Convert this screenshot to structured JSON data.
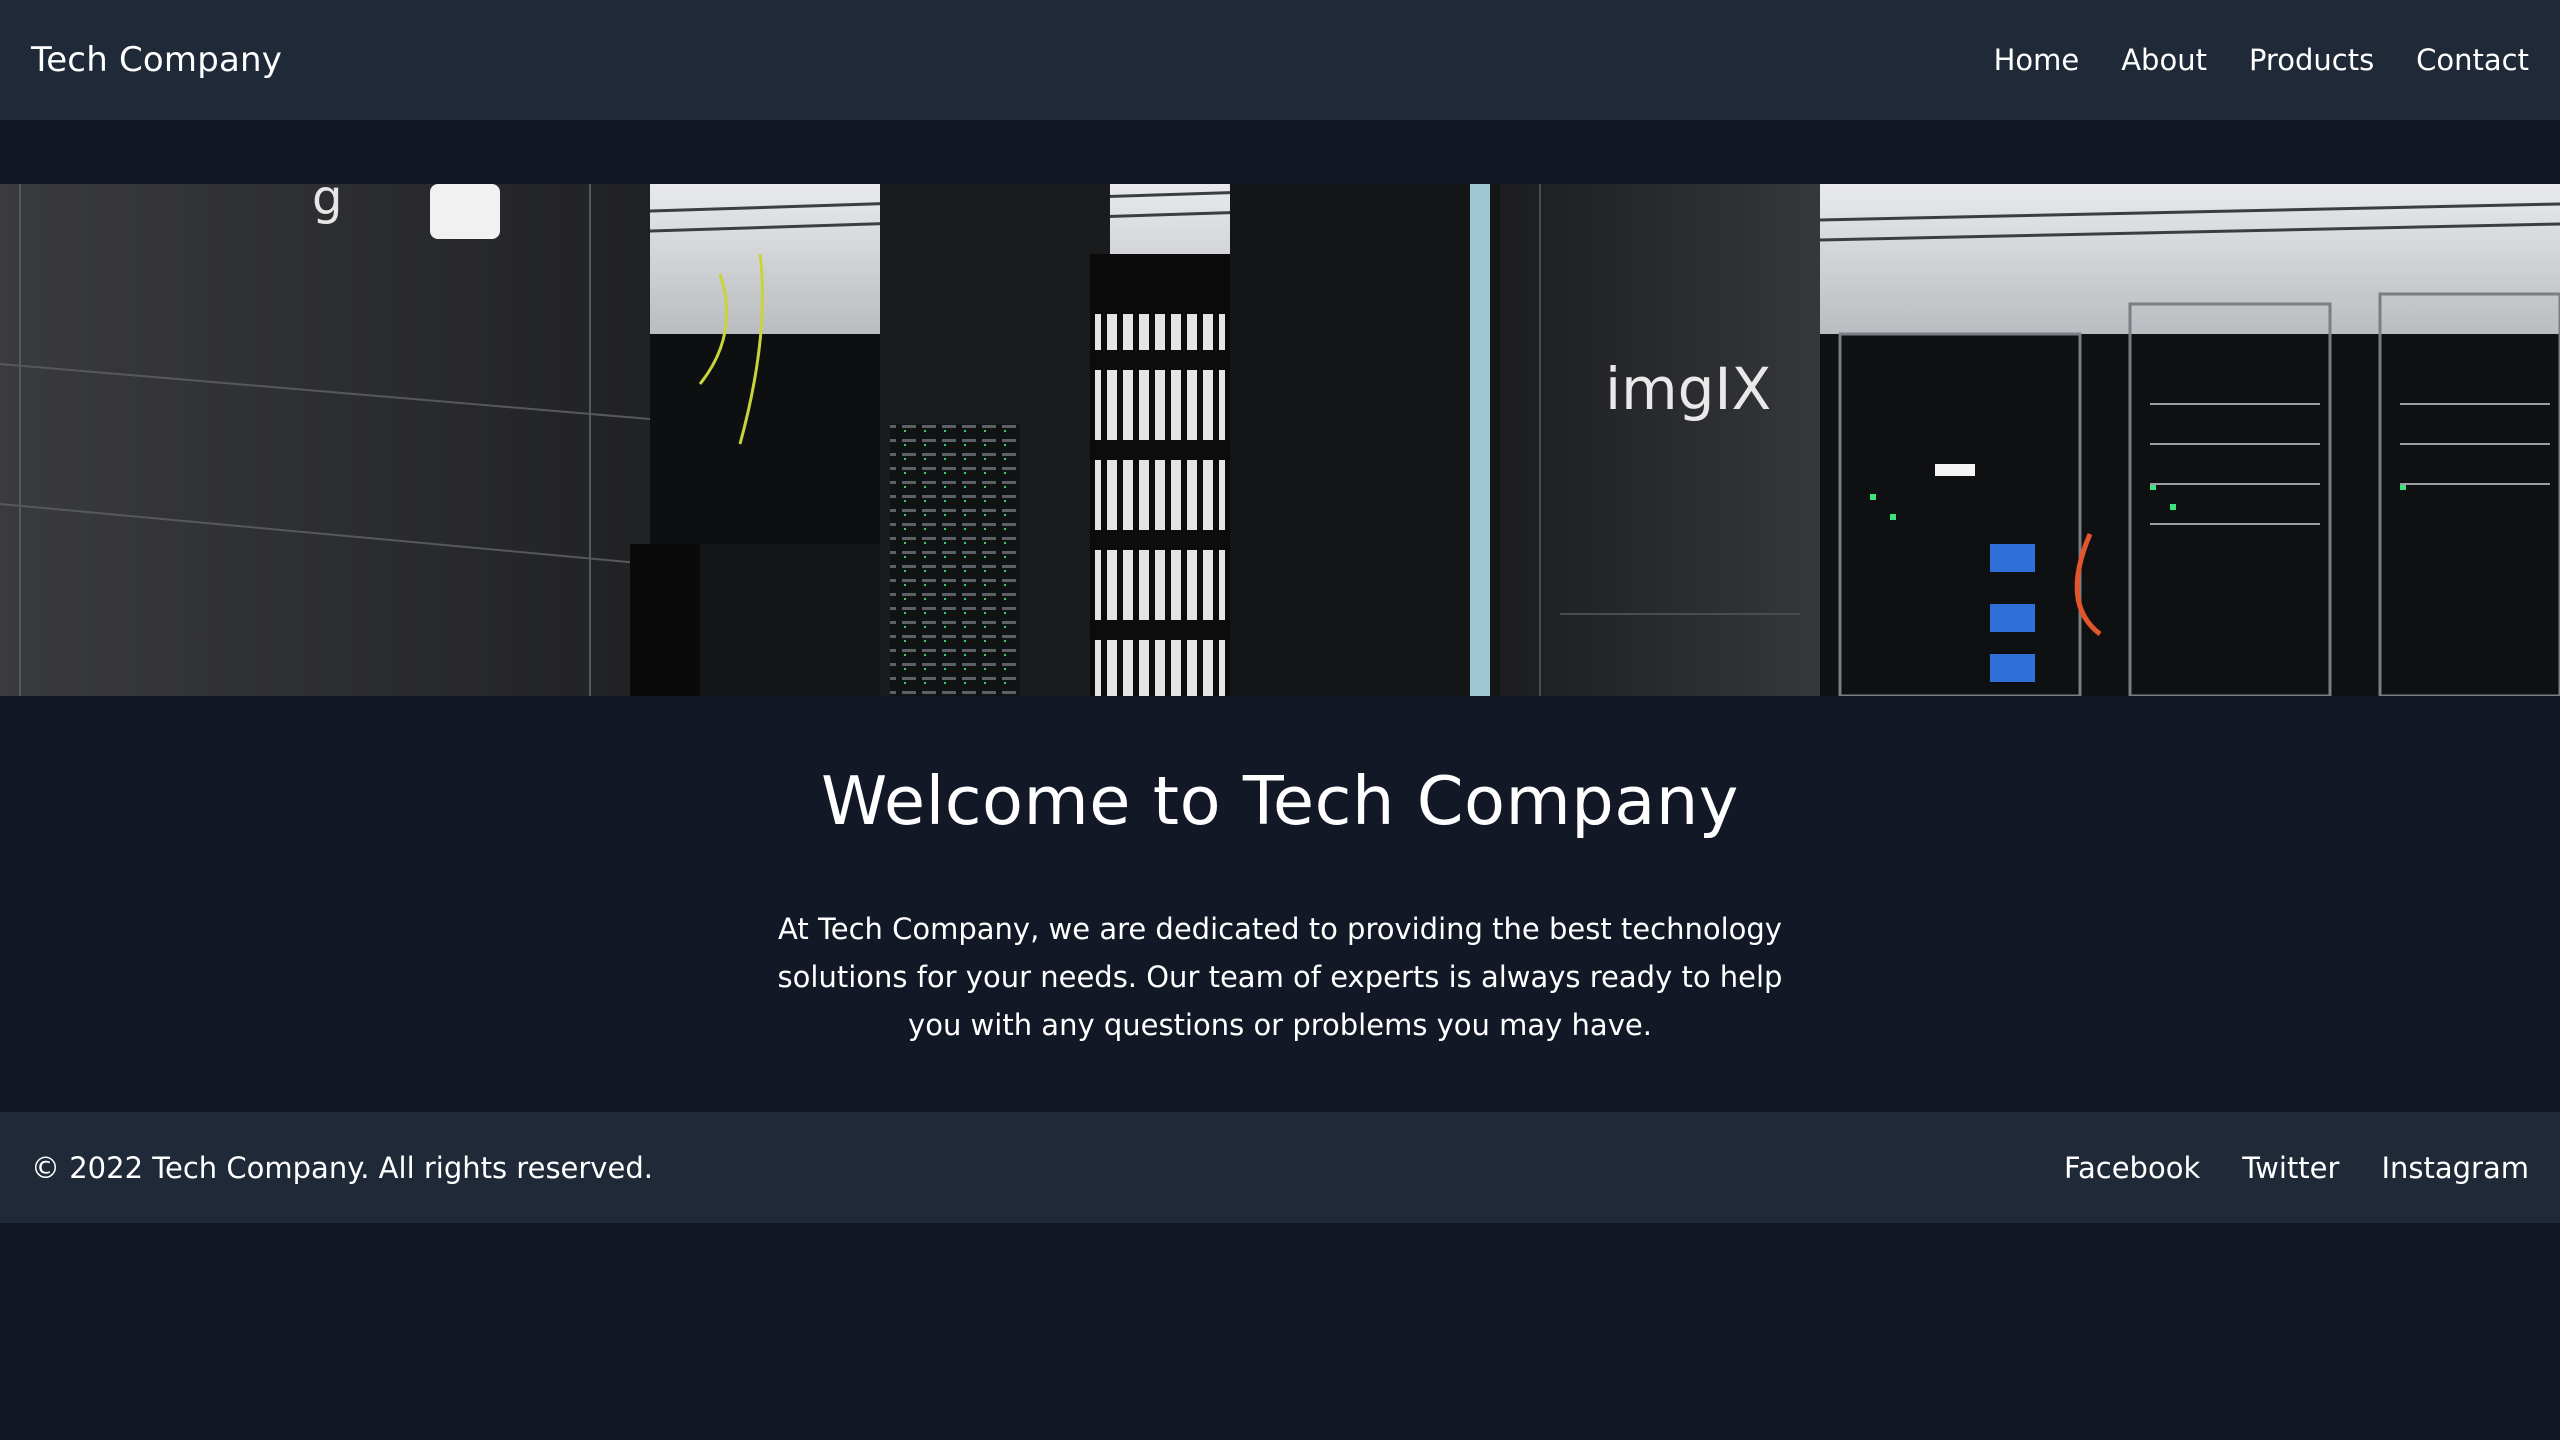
{
  "header": {
    "brand": "Tech Company",
    "nav": [
      {
        "label": "Home"
      },
      {
        "label": "About"
      },
      {
        "label": "Products"
      },
      {
        "label": "Contact"
      }
    ]
  },
  "hero": {
    "image_label": "imgIX"
  },
  "main": {
    "title": "Welcome to Tech Company",
    "paragraph": "At Tech Company, we are dedicated to providing the best technology solutions for your needs. Our team of experts is always ready to help you with any questions or problems you may have."
  },
  "footer": {
    "copyright": "© 2022 Tech Company. All rights reserved.",
    "links": [
      {
        "label": "Facebook"
      },
      {
        "label": "Twitter"
      },
      {
        "label": "Instagram"
      }
    ]
  },
  "colors": {
    "page_background": "#121826",
    "bar_background": "#202938",
    "text": "#ffffff"
  }
}
